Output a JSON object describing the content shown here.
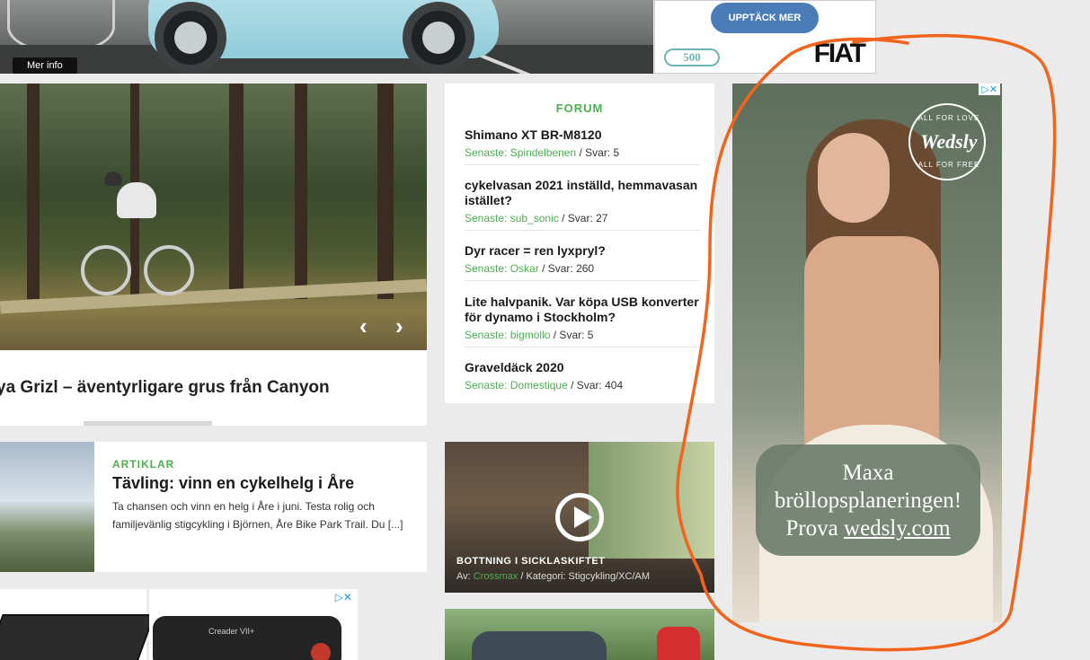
{
  "top_banner": {
    "mer_info": "Mer info",
    "cta": "UPPTÄCK MER",
    "badge_500": "500",
    "brand": "FIAT"
  },
  "hero": {
    "title": "ya Grizl – äventyrligare grus från Canyon",
    "prev_icon": "chevron-left-icon",
    "next_icon": "chevron-right-icon"
  },
  "forum": {
    "heading": "FORUM",
    "items": [
      {
        "title": "Shimano XT BR-M8120",
        "latest_label": "Senaste:",
        "user": "Spindelbenen",
        "replies": "/ Svar: 5"
      },
      {
        "title": "cykelvasan 2021 inställd, hemmavasan istället?",
        "latest_label": "Senaste:",
        "user": "sub_sonic",
        "replies": "/ Svar: 27"
      },
      {
        "title": "Dyr racer = ren lyxpryl?",
        "latest_label": "Senaste:",
        "user": "Oskar",
        "replies": "/ Svar: 260"
      },
      {
        "title": "Lite halvpanik. Var köpa USB konverter för dynamo i Stockholm?",
        "latest_label": "Senaste:",
        "user": "bigmollo",
        "replies": "/ Svar: 5"
      },
      {
        "title": "Graveldäck 2020",
        "latest_label": "Senaste:",
        "user": "Domestique",
        "replies": "/ Svar: 404"
      }
    ]
  },
  "article": {
    "category": "ARTIKLAR",
    "title": "Tävling: vinn en cykelhelg i Åre",
    "excerpt": "Ta chansen och vinn en helg i Åre i juni. Testa rolig och familjevänlig stigcykling i Björnen, Åre Bike Park Trail. Du [...]"
  },
  "video": {
    "title": "BOTTNING I SICKLASKIFTET",
    "by_label": "Av:",
    "author": "Crossmax",
    "category_label": "/ Kategori:",
    "category": "Stigcykling/XC/AM"
  },
  "bottom_ads": {
    "scanner_label": "Creader VII+",
    "adchoice": "▷✕"
  },
  "wedsly_ad": {
    "logo_top": "ALL FOR LOVE",
    "logo_name": "Wedsly",
    "logo_bottom": "ALL FOR FREE",
    "line1": "Maxa",
    "line2": "bröllopsplaneringen!",
    "line3_prefix": "Prova",
    "line3_link": "wedsly.com",
    "adchoice": "▷✕"
  },
  "colors": {
    "accent_green": "#4caf50",
    "annotation_orange": "#f0641e",
    "fiat_blue": "#4a7db8"
  }
}
